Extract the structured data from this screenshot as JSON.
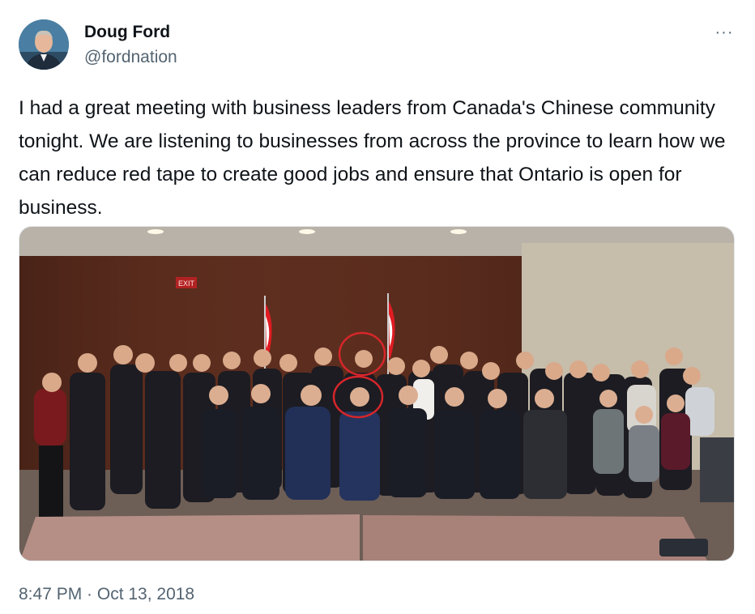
{
  "author": {
    "name": "Doug Ford",
    "handle": "@fordnation",
    "avatar_icon": "profile-photo"
  },
  "menu_icon": "more-dots-icon",
  "more_glyph": "···",
  "tweet_text": "I had a great meeting with business leaders from Canada's Chinese community tonight. We are listening to businesses from across the province to learn how we can reduce red tape to create good jobs and ensure that Ontario is open for business.",
  "media": {
    "kind": "photo",
    "exit_sign": "EXIT"
  },
  "timestamp": "8:47 PM · Oct 13, 2018",
  "colors": {
    "text": "#0f1419",
    "secondary": "#536471",
    "annotation": "#d6262a"
  }
}
